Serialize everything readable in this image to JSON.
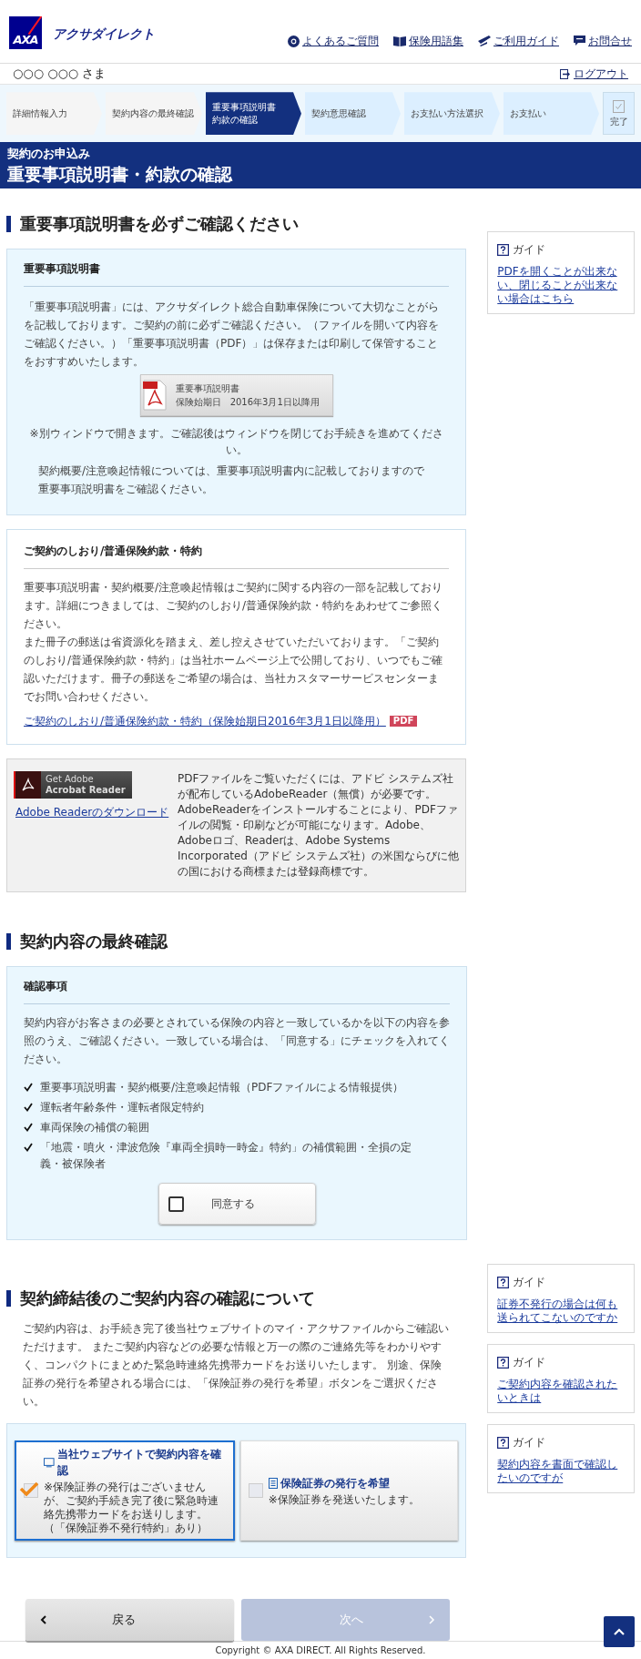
{
  "header": {
    "logo_text": "AXA",
    "brand": "アクサダイレクト",
    "links": [
      {
        "kind": "faq",
        "label": "よくあるご質問"
      },
      {
        "kind": "glossary",
        "label": "保険用語集"
      },
      {
        "kind": "guide",
        "label": "ご利用ガイド"
      },
      {
        "kind": "contact",
        "label": "お問合せ"
      }
    ]
  },
  "user_bar": {
    "name": "○○○ ○○○ さま",
    "logout": "ログアウト"
  },
  "steps": [
    {
      "lines": [
        "詳細情報入力"
      ],
      "completed": true,
      "selected": false,
      "kind": "step"
    },
    {
      "lines": [
        "契約内容の最終確認"
      ],
      "completed": true,
      "selected": false,
      "kind": "step"
    },
    {
      "lines": [
        "重要事項説明書",
        "約款の確認"
      ],
      "completed": false,
      "selected": true,
      "kind": "step"
    },
    {
      "lines": [
        "契約意思確認"
      ],
      "completed": false,
      "selected": false,
      "kind": "step"
    },
    {
      "lines": [
        "お支払い方法選択"
      ],
      "completed": false,
      "selected": false,
      "kind": "step"
    },
    {
      "lines": [
        "お支払い"
      ],
      "completed": false,
      "selected": false,
      "kind": "step"
    },
    {
      "lines": [
        "完了"
      ],
      "completed": false,
      "selected": false,
      "kind": "final"
    }
  ],
  "banner": {
    "subtitle": "契約のお申込み",
    "title": "重要事項説明書・約款の確認"
  },
  "section_1": {
    "title": "重要事項説明書を必ずご確認ください",
    "guides": [
      {
        "title": "ガイド",
        "link": "PDFを開くことが出来ない、閉じることが出来ない場合はこちら"
      }
    ],
    "important_box": {
      "heading": "重要事項説明書",
      "text": "「重要事項説明書」には、アクサダイレクト総合自動車保険について大切なことがらを記載しております。ご契約の前に必ずご確認ください。（ファイルを開いて内容をご確認ください。）「重要事項説明書（PDF）」は保存または印刷して保管することをおすすめいたします。",
      "pdf_button": {
        "line_1": "重要事項説明書",
        "line_2": "保険始期日　2016年3月1日以降用"
      },
      "note": "※別ウィンドウで開きます。ご確認後はウィンドウを閉じてお手続きを進めてください。",
      "text_2": "契約概要/注意喚起情報については、重要事項説明書内に記載しておりますので重要事項説明書をご確認ください。"
    },
    "terms_box": {
      "heading": "ご契約のしおり/普通保険約款・特約",
      "paragraphs": [
        "重要事項説明書・契約概要/注意喚起情報はご契約に関する内容の一部を記載しております。詳細につきましては、ご契約のしおり/普通保険約款・特約をあわせてご参照ください。",
        "また冊子の郵送は省資源化を踏まえ、差し控えさせていただいております。「ご契約のしおり/普通保険約款・特約」は当社ホームページ上で公開しており、いつでもご確認いただけます。冊子の郵送をご希望の場合は、当社カスタマーサービスセンターまでお問い合わせください。"
      ],
      "link": "ご契約のしおり/普通保険約款・特約（保険始期日2016年3月1日以降用）",
      "link_badge": "PDF"
    },
    "adobe_box": {
      "badge_line_1": "Get Adobe",
      "badge_line_2": "Acrobat Reader",
      "download_link": "Adobe Readerのダウンロード",
      "text": "PDFファイルをご覧いただくには、アドビ システムズ社が配布しているAdobeReader（無償）が必要です。AdobeReaderをインストールすることにより、PDFファイルの閲覧・印刷などが可能になります。Adobe、Adobeロゴ、Readerは、Adobe Systems Incorporated（アドビ システムズ社）の米国ならびに他の国における商標または登録商標です。"
    }
  },
  "section_2": {
    "title": "契約内容の最終確認",
    "box": {
      "heading": "確認事項",
      "text": "契約内容がお客さまの必要とされている保険の内容と一致しているかを以下の内容を参照のうえ、ご確認ください。一致している場合は、「同意する」にチェックを入れてください。",
      "items": [
        "重要事項説明書・契約概要/注意喚起情報（PDFファイルによる情報提供）",
        "運転者年齢条件・運転者限定特約",
        "車両保険の補償の範囲",
        "「地震・噴火・津波危険『車両全損時一時金』特約」の補償範囲・全損の定義・被保険者"
      ],
      "agree": {
        "label": "同意する",
        "checked": false
      }
    }
  },
  "section_3": {
    "title": "契約締結後のご契約内容の確認について",
    "text": "ご契約内容は、お手続き完了後当社ウェブサイトのマイ・アクサファイルからご確認いただけます。 またご契約内容などの必要な情報と万一の際のご連絡先等をわかりやすく、コンパクトにまとめた緊急時連絡先携帯カードをお送りいたします。 別途、保険証券の発行を希望される場合には、「保険証券の発行を希望」ボタンをご選択ください。",
    "options": [
      {
        "kind": "web",
        "title": "当社ウェブサイトで契約内容を確認",
        "note": "※保険証券の発行はございませんが、ご契約手続き完了後に緊急時連絡先携帯カードをお送りします。（「保険証券不発行特約」あり）",
        "selected": true
      },
      {
        "kind": "paper",
        "title": "保険証券の発行を希望",
        "note": "※保険証券を発送いたします。",
        "selected": false
      }
    ],
    "guides": [
      {
        "title": "ガイド",
        "link": "証券不発行の場合は何も送られてこないのですか"
      },
      {
        "title": "ガイド",
        "link": "ご契約内容を確認されたいときは"
      },
      {
        "title": "ガイド",
        "link": "契約内容を書面で確認したいのですが"
      }
    ]
  },
  "nav": {
    "back": "戻る",
    "next": {
      "label": "次へ",
      "disabled": true
    }
  },
  "footer": {
    "copyright": "Copyright © AXA DIRECT. All Rights Reserved."
  }
}
